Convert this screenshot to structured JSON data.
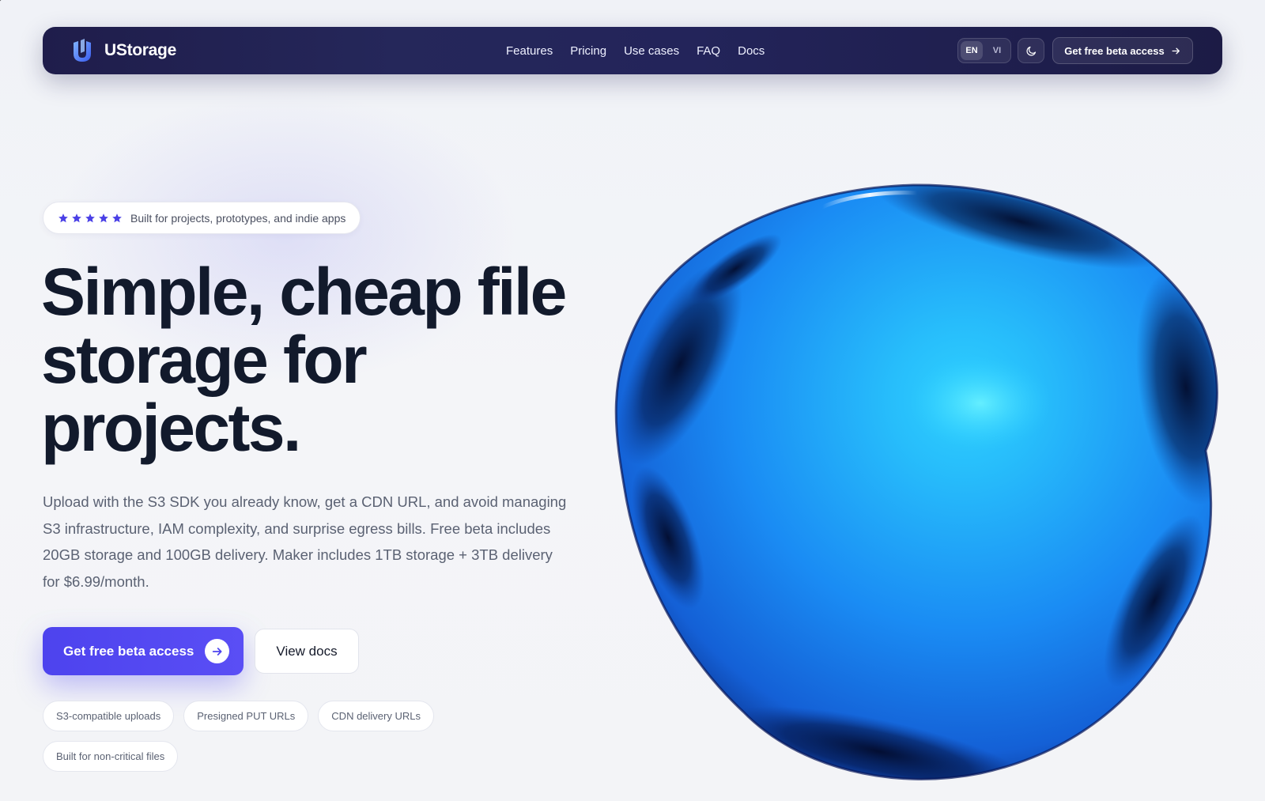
{
  "nav": {
    "brand": "UStorage",
    "links": [
      "Features",
      "Pricing",
      "Use cases",
      "FAQ",
      "Docs"
    ],
    "languages": [
      "EN",
      "VI"
    ],
    "active_language": "EN",
    "theme_toggle_icon": "moon-icon",
    "cta_label": "Get free beta access",
    "cta_icon": "arrow-right-icon"
  },
  "hero": {
    "rating_stars": 5,
    "rating_text": "Built for projects, prototypes, and indie apps",
    "headline_lines": [
      "Simple, cheap file",
      "storage for",
      "projects."
    ],
    "description_lines": [
      "Upload with the S3 SDK you already know, get a CDN URL, and avoid managing",
      "S3 infrastructure, IAM complexity, and surprise egress bills. Free beta includes",
      "20GB storage and 100GB delivery. Maker includes 1TB storage + 3TB delivery",
      "for $6.99/month."
    ],
    "primary_cta": "Get free beta access",
    "secondary_cta": "View docs",
    "tags": [
      "S3-compatible uploads",
      "Presigned PUT URLs",
      "CDN delivery URLs",
      "Built for non-critical files"
    ]
  },
  "colors": {
    "nav_bg": "#22234f",
    "accent": "#5048f0",
    "star": "#4a40e6",
    "heading": "#121a2c",
    "body_text": "#5b6273",
    "blob_blue": "#1e90ff"
  }
}
